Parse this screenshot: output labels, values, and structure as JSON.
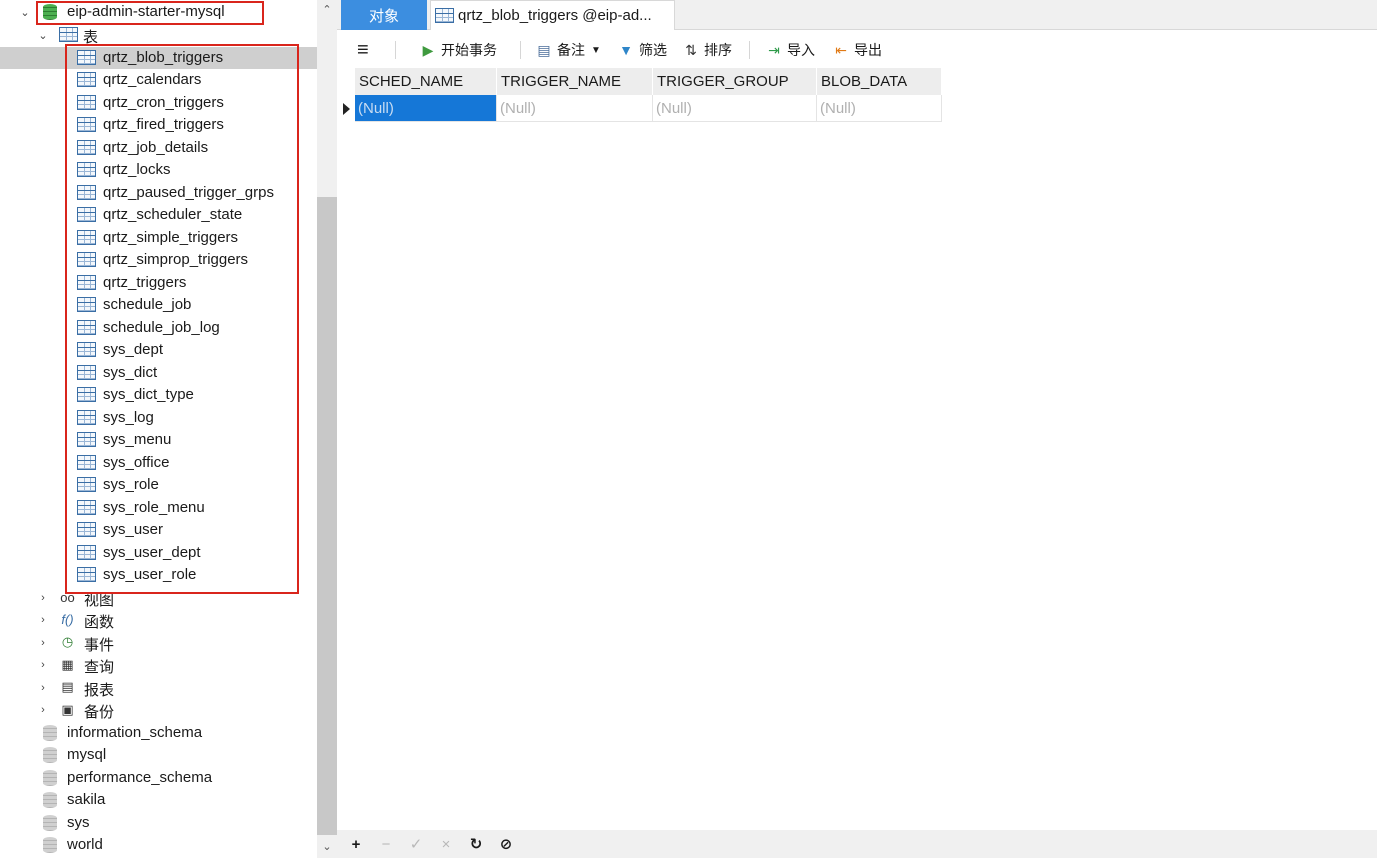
{
  "navigator": {
    "connection_name": "eip-admin-starter-mysql",
    "tables_group_label": "表",
    "tables": [
      "qrtz_blob_triggers",
      "qrtz_calendars",
      "qrtz_cron_triggers",
      "qrtz_fired_triggers",
      "qrtz_job_details",
      "qrtz_locks",
      "qrtz_paused_trigger_grps",
      "qrtz_scheduler_state",
      "qrtz_simple_triggers",
      "qrtz_simprop_triggers",
      "qrtz_triggers",
      "schedule_job",
      "schedule_job_log",
      "sys_dept",
      "sys_dict",
      "sys_dict_type",
      "sys_log",
      "sys_menu",
      "sys_office",
      "sys_role",
      "sys_role_menu",
      "sys_user",
      "sys_user_dept",
      "sys_user_role"
    ],
    "selected_table": "qrtz_blob_triggers",
    "groups": [
      {
        "label": "视图",
        "icon": "glasses-icon"
      },
      {
        "label": "函数",
        "icon": "function-icon"
      },
      {
        "label": "事件",
        "icon": "event-clock-icon"
      },
      {
        "label": "查询",
        "icon": "query-icon"
      },
      {
        "label": "报表",
        "icon": "report-icon"
      },
      {
        "label": "备份",
        "icon": "backup-icon"
      }
    ],
    "other_databases": [
      "information_schema",
      "mysql",
      "performance_schema",
      "sakila",
      "sys",
      "world"
    ]
  },
  "tabs": {
    "objects_label": "对象",
    "table_tab_label": "qrtz_blob_triggers @eip-ad..."
  },
  "toolbar": {
    "menu_icon": "hamburger-icon",
    "begin_transaction": "开始事务",
    "memo": "备注",
    "filter": "筛选",
    "sort": "排序",
    "import": "导入",
    "export": "导出"
  },
  "grid": {
    "columns": [
      "SCHED_NAME",
      "TRIGGER_NAME",
      "TRIGGER_GROUP",
      "BLOB_DATA"
    ],
    "rows": [
      [
        "(Null)",
        "(Null)",
        "(Null)",
        "(Null)"
      ]
    ]
  },
  "statusbar": {
    "add": "+",
    "remove": "−",
    "apply": "✓",
    "discard": "×",
    "refresh": "↻",
    "stop": "⊘"
  },
  "colors": {
    "accent": "#3c8ee0",
    "selection": "#1577d7",
    "highlight_box": "#d9251c",
    "db_active": "#4caf50"
  }
}
